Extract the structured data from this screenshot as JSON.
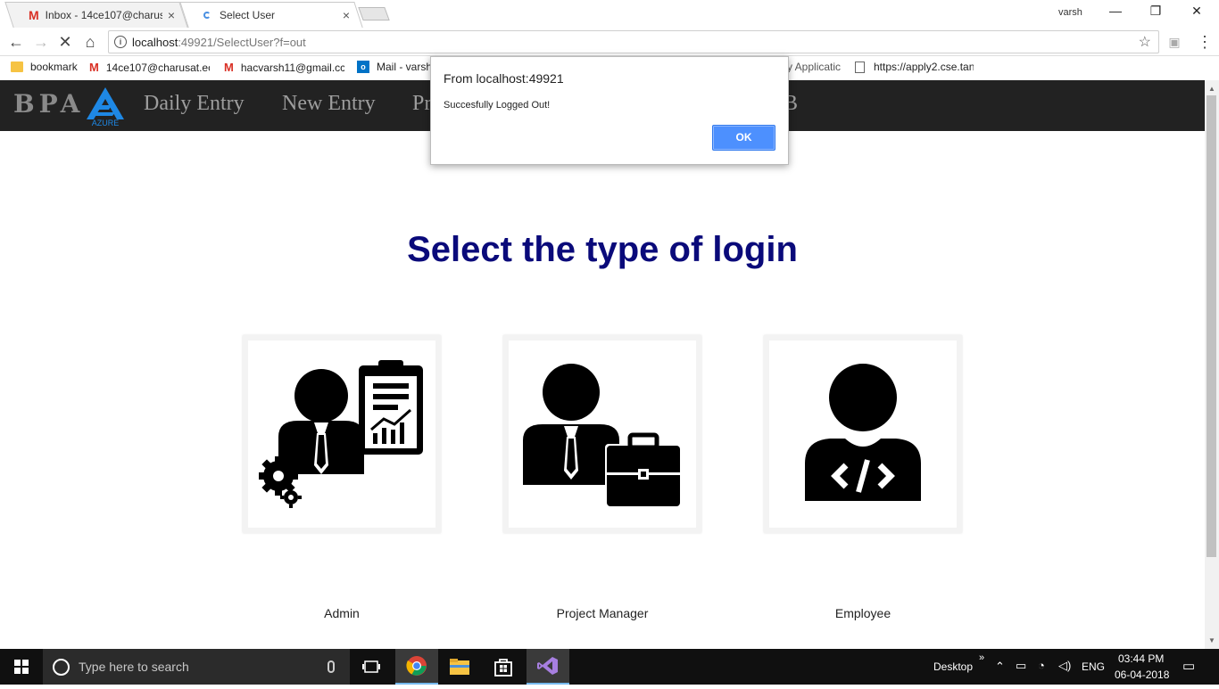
{
  "browser": {
    "tabs": [
      {
        "title": "Inbox - 14ce107@charus",
        "close": "×"
      },
      {
        "title": "Select User",
        "close": "×"
      }
    ],
    "window_user": "varsh",
    "window_controls": {
      "minimize": "—",
      "restore": "❐",
      "close": "✕"
    },
    "url_host": "localhost",
    "url_rest": ":49921/SelectUser?f=out",
    "info_icon": "i",
    "bookmarks": [
      {
        "label": "bookmark",
        "icon": "folder"
      },
      {
        "label": "14ce107@charusat.ec",
        "icon": "gmail"
      },
      {
        "label": "hacvarsh11@gmail.cc",
        "icon": "gmail"
      },
      {
        "label": "Mail - varsh",
        "icon": "outlook"
      },
      {
        "label": "y Applicatic",
        "icon": "none"
      },
      {
        "label": "https://apply2.cse.tan",
        "icon": "document"
      }
    ]
  },
  "site": {
    "brand": "BPA",
    "logo_text": "AZURE",
    "nav": [
      "Daily Entry",
      "New Entry",
      "Pr",
      "B"
    ],
    "heading": "Select the type of login",
    "cards": [
      {
        "label": "Admin",
        "icon": "admin-icon"
      },
      {
        "label": "Project Manager",
        "icon": "project-manager-icon"
      },
      {
        "label": "Employee",
        "icon": "employee-icon"
      }
    ]
  },
  "dialog": {
    "title": "From localhost:49921",
    "message": "Succesfully Logged Out!",
    "ok": "OK"
  },
  "taskbar": {
    "search_placeholder": "Type here to search",
    "desktop": "Desktop",
    "chevron": "»",
    "language": "ENG",
    "time": "03:44 PM",
    "date": "06-04-2018"
  },
  "colors": {
    "heading": "#0a0a7a",
    "navbar_bg": "#222222",
    "ok_button": "#4d90fe",
    "azure_logo": "#1e88e5"
  }
}
